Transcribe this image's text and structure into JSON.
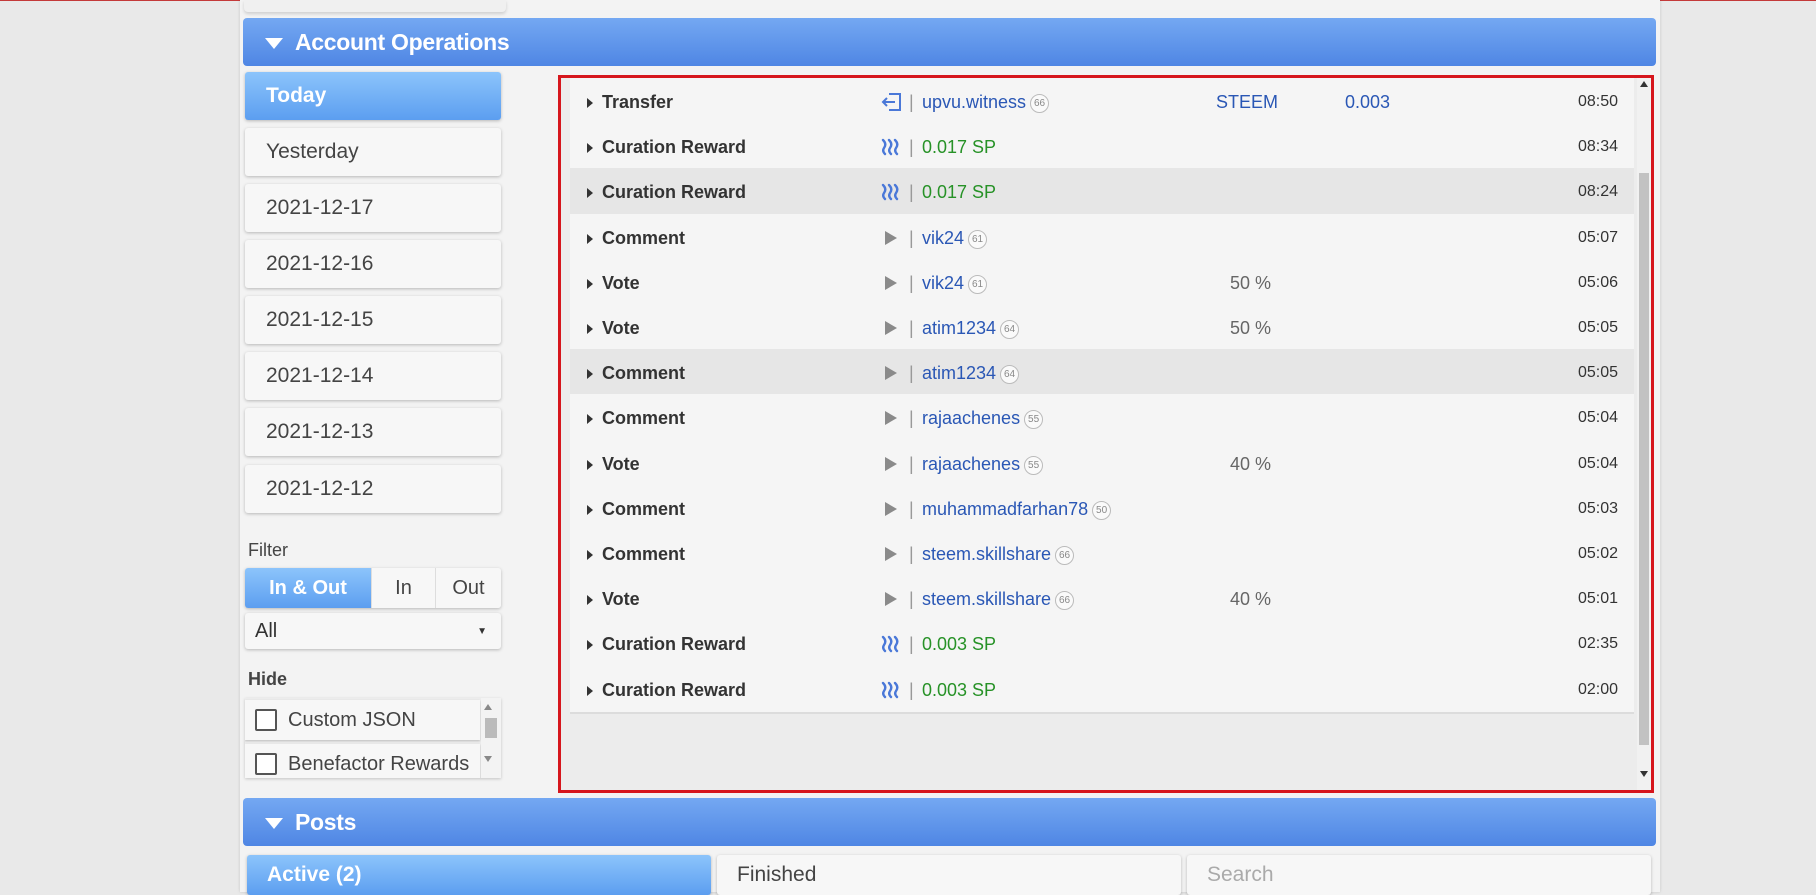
{
  "account_operations": {
    "title": "Account Operations",
    "dates": [
      "Today",
      "Yesterday",
      "2021-12-17",
      "2021-12-16",
      "2021-12-15",
      "2021-12-14",
      "2021-12-13",
      "2021-12-12"
    ],
    "filter_label": "Filter",
    "filter_options": [
      "In & Out",
      "In",
      "Out"
    ],
    "select_value": "All",
    "hide_label": "Hide",
    "hide_items": [
      "Custom JSON",
      "Benefactor Rewards"
    ],
    "operations": [
      {
        "type": "Transfer",
        "icon": "transfer-in-icon",
        "target": "upvu.witness",
        "rep": "66",
        "col1": "STEEM",
        "col2": "0.003",
        "time": "08:50"
      },
      {
        "type": "Curation Reward",
        "icon": "steem-logo-icon",
        "target": "0.017 SP",
        "time": "08:34"
      },
      {
        "type": "Curation Reward",
        "icon": "steem-logo-icon",
        "target": "0.017 SP",
        "time": "08:24"
      },
      {
        "type": "Comment",
        "icon": "play-icon",
        "target": "vik24",
        "rep": "61",
        "time": "05:07"
      },
      {
        "type": "Vote",
        "icon": "play-icon",
        "target": "vik24",
        "rep": "61",
        "col1": "50 %",
        "time": "05:06"
      },
      {
        "type": "Vote",
        "icon": "play-icon",
        "target": "atim1234",
        "rep": "64",
        "col1": "50 %",
        "time": "05:05"
      },
      {
        "type": "Comment",
        "icon": "play-icon",
        "target": "atim1234",
        "rep": "64",
        "time": "05:05"
      },
      {
        "type": "Comment",
        "icon": "play-icon",
        "target": "rajaachenes",
        "rep": "55",
        "time": "05:04"
      },
      {
        "type": "Vote",
        "icon": "play-icon",
        "target": "rajaachenes",
        "rep": "55",
        "col1": "40 %",
        "time": "05:04"
      },
      {
        "type": "Comment",
        "icon": "play-icon",
        "target": "muhammadfarhan78",
        "rep": "50",
        "time": "05:03"
      },
      {
        "type": "Comment",
        "icon": "play-icon",
        "target": "steem.skillshare",
        "rep": "66",
        "time": "05:02"
      },
      {
        "type": "Vote",
        "icon": "play-icon",
        "target": "steem.skillshare",
        "rep": "66",
        "col1": "40 %",
        "time": "05:01"
      },
      {
        "type": "Curation Reward",
        "icon": "steem-logo-icon",
        "target": "0.003 SP",
        "time": "02:35"
      },
      {
        "type": "Curation Reward",
        "icon": "steem-logo-icon",
        "target": "0.003 SP",
        "time": "02:00"
      }
    ]
  },
  "posts": {
    "title": "Posts",
    "tabs": [
      "Active (2)",
      "Finished"
    ],
    "search_placeholder": "Search"
  },
  "colors": {
    "accent": "#5c9ef0",
    "selection_border": "#d6161d",
    "link": "#2a57b5",
    "reward": "#279227"
  }
}
